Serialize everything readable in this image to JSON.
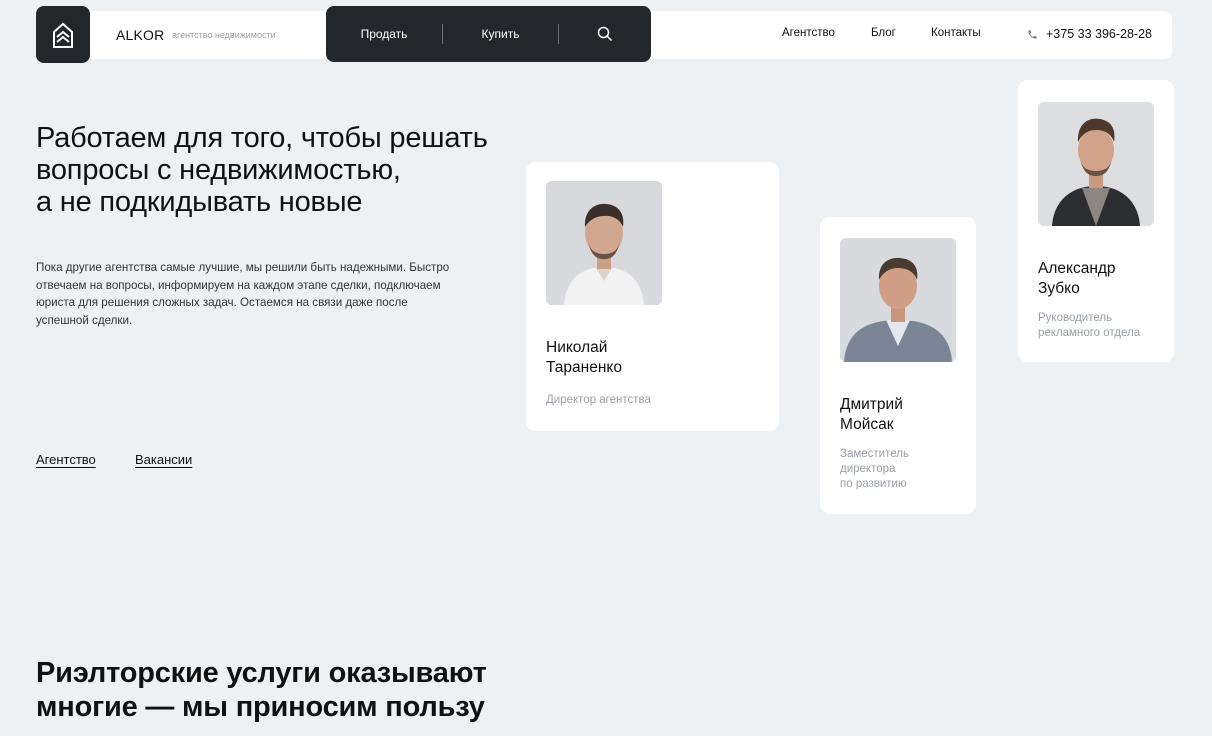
{
  "header": {
    "brand": "ALKOR",
    "brand_subtitle": "агентство недвижимости",
    "nav_sell": "Продать",
    "nav_buy": "Купить",
    "links": [
      "Агентство",
      "Блог",
      "Контакты"
    ],
    "phone": "+375 33 396-28-28"
  },
  "hero": {
    "title_lines": [
      "Работаем для того, чтобы решать",
      "вопросы с недвижимостью,",
      "а не подкидывать новые"
    ],
    "text_lines": [
      "Пока другие агентства самые лучшие, мы решили быть надежными. Быстро",
      "отвечаем на вопросы, информируем на каждом этапе сделки, подключаем",
      "юриста для решения сложных задач. Остаемся на связи даже после",
      "успешной сделки."
    ],
    "link_agency": "Агентство",
    "link_vacancies": "Вакансии"
  },
  "team": [
    {
      "name_lines": [
        "Николай",
        "Тараненко"
      ],
      "role_lines": [
        "Директор агентства"
      ]
    },
    {
      "name_lines": [
        "Дмитрий",
        "Мойсак"
      ],
      "role_lines": [
        "Заместитель",
        "директора",
        "по развитию"
      ]
    },
    {
      "name_lines": [
        "Александр",
        "Зубко"
      ],
      "role_lines": [
        "Руководитель",
        "рекламного отдела"
      ]
    }
  ],
  "section": {
    "title_lines": [
      "Риэлторские услуги оказывают",
      "многие — мы приносим пользу"
    ]
  },
  "colors": {
    "dark": "#23272b",
    "background": "#eef1f4",
    "muted": "#9aa0a6"
  }
}
